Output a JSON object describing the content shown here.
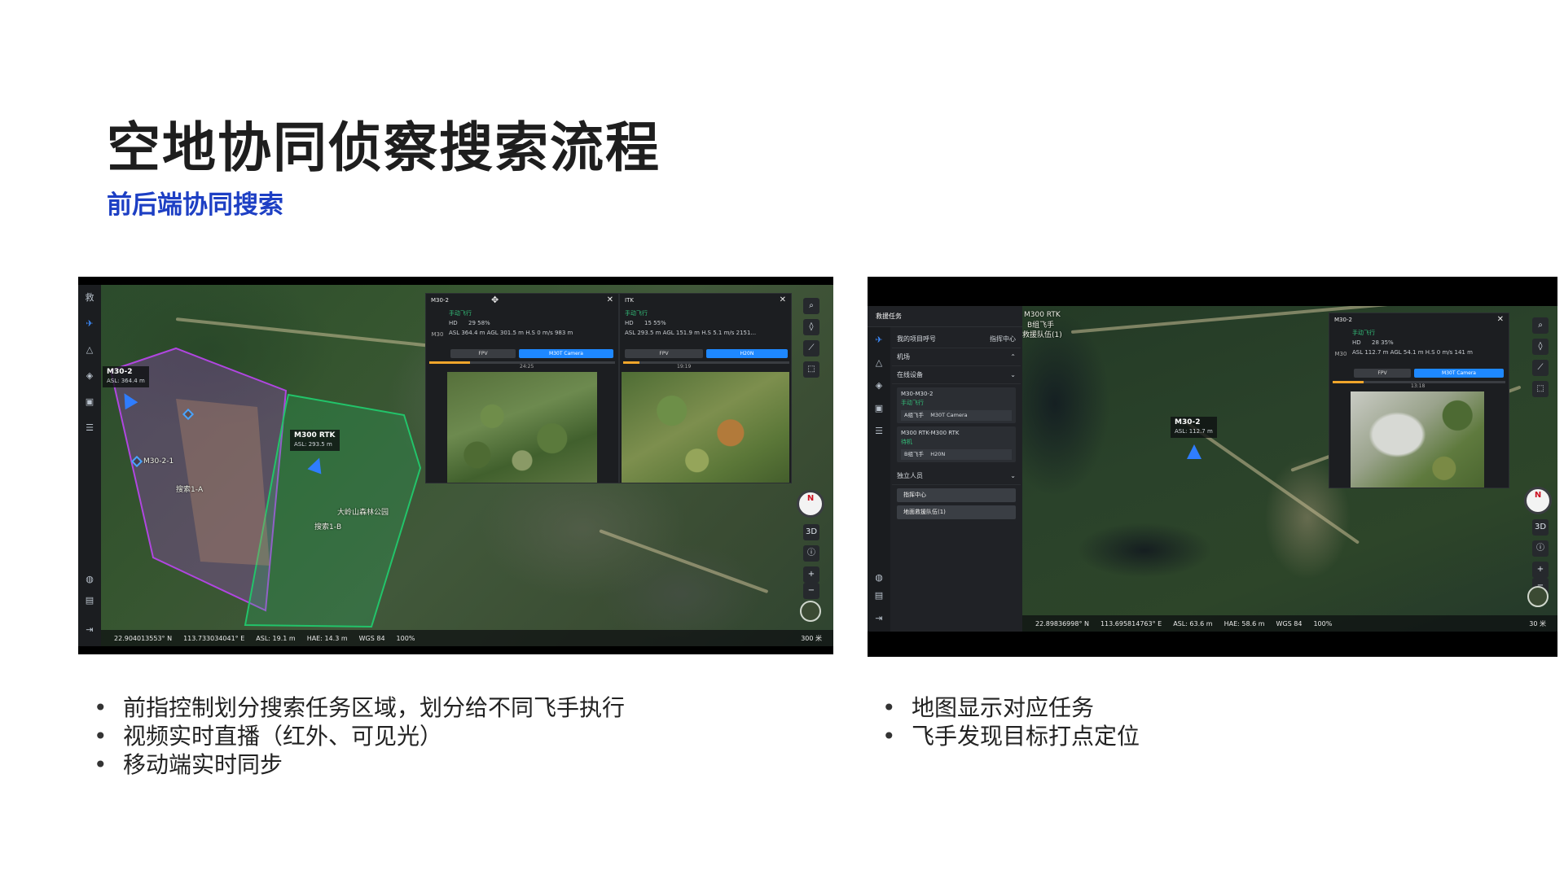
{
  "slide": {
    "title": "空地协同侦察搜索流程",
    "subtitle": "前后端协同搜索"
  },
  "left_screenshot": {
    "sidebar_top_label": "救",
    "drones": [
      {
        "name": "M30-2",
        "asl": "ASL: 364.4 m"
      },
      {
        "name": "M300 RTK",
        "asl": "ASL: 293.5 m"
      }
    ],
    "map_labels": [
      "M30-2-1",
      "搜索1-A",
      "搜索1-B",
      "大岭山森林公园"
    ],
    "video_panels": [
      {
        "title": "M30-2",
        "mode": "手动飞行",
        "model": "M30",
        "hd": "HD",
        "stats_row1": "29     58%",
        "stats_row2": "ASL 364.4 m   AGL 301.5 m   H.S 0 m/s   983 m",
        "progress": "24:25",
        "btn_fpv": "FPV",
        "btn_camera": "M30T Camera"
      },
      {
        "title": "ITK",
        "mode": "手动飞行",
        "model": "",
        "hd": "HD",
        "stats_row1": "15     55%",
        "stats_row2": "ASL 293.5 m   AGL 151.9 m   H.S 5.1 m/s   2151...",
        "progress": "19:19",
        "btn_fpv": "FPV",
        "btn_camera": "H20N"
      }
    ],
    "status_bar": {
      "lat": "22.904013553° N",
      "lon": "113.733034041° E",
      "asl": "ASL: 19.1 m",
      "hae": "HAE: 14.3 m",
      "datum": "WGS 84",
      "percent": "100%",
      "scale": "300 米"
    },
    "tools": {
      "compass": "N",
      "mode_3d": "3D",
      "zoom_in": "+",
      "zoom_out": "−"
    }
  },
  "right_screenshot": {
    "panel_title": "救援任务",
    "rows": {
      "my_project": "我的项目呼号",
      "dispatch_center": "指挥中心",
      "airport": "机场",
      "online_devices": "在线设备",
      "independent_people": "独立人员"
    },
    "device_cards": [
      {
        "name": "M30-M30-2",
        "status": "手动飞行",
        "pilot": "A组飞手",
        "camera": "M30T Camera"
      },
      {
        "name": "M300 RTK-M300 RTK",
        "status": "待机",
        "pilot": "B组飞手",
        "camera": "H20N"
      }
    ],
    "people_buttons": [
      "指挥中心",
      "地面救援队伍(1)"
    ],
    "map_tags": [
      "M300 RTK",
      "B组飞手",
      "救援队伍(1)"
    ],
    "drone": {
      "name": "M30-2",
      "asl": "ASL: 112.7 m"
    },
    "video_panel": {
      "title": "M30-2",
      "mode": "手动飞行",
      "model": "M30",
      "hd": "HD",
      "stats_row1": "28     35%",
      "stats_row2": "ASL 112.7 m   AGL 54.1 m   H.S 0 m/s   141 m",
      "progress": "13:18",
      "btn_fpv": "FPV",
      "btn_camera": "M30T Camera"
    },
    "status_bar": {
      "lat": "22.89836998° N",
      "lon": "113.695814763° E",
      "asl": "ASL: 63.6 m",
      "hae": "HAE: 58.6 m",
      "datum": "WGS 84",
      "percent": "100%",
      "scale": "30 米"
    },
    "tools": {
      "compass": "N",
      "mode_3d": "3D",
      "zoom_in": "+",
      "zoom_out": "−"
    }
  },
  "bullets_left": [
    "前指控制划分搜索任务区域，划分给不同飞手执行",
    "视频实时直播（红外、可见光）",
    "移动端实时同步"
  ],
  "bullets_right": [
    "地图显示对应任务",
    "飞手发现目标打点定位"
  ],
  "colors": {
    "title": "#1e1e1e",
    "subtitle": "#1d3fc4",
    "zone_purple": "#b046e0",
    "zone_green": "#22c46a",
    "drone_blue": "#2f7dff",
    "accent_button": "#1e88ff"
  },
  "icons": [
    "drone-icon",
    "warning-icon",
    "layers-icon",
    "media-icon",
    "list-icon",
    "globe-icon",
    "report-icon",
    "logout-icon",
    "search-icon",
    "pin-icon",
    "ruler-icon",
    "polygon-icon",
    "compass-icon",
    "info-icon",
    "close-icon",
    "move-icon"
  ]
}
